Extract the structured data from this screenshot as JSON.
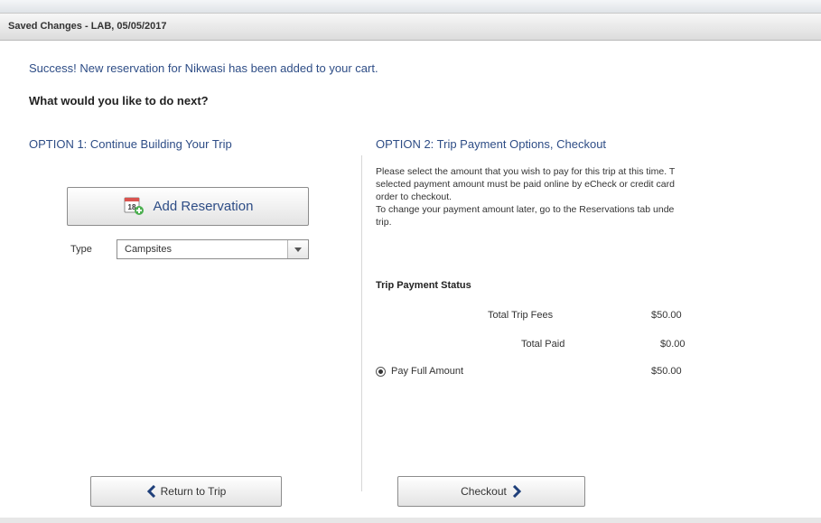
{
  "dialog": {
    "title": "Saved Changes - LAB, 05/05/2017"
  },
  "messages": {
    "success": "Success! New reservation for Nikwasi has been added to your cart.",
    "next": "What would you like to do next?"
  },
  "option1": {
    "heading": "OPTION 1: Continue Building Your Trip",
    "add_button": "Add Reservation",
    "type_label": "Type",
    "type_selected": "Campsites",
    "return_button": "Return to Trip"
  },
  "option2": {
    "heading": "OPTION 2: Trip Payment Options, Checkout",
    "paragraph_lines": [
      "Please select the amount that you wish to pay for this trip at this time. T",
      "selected payment amount must be paid online by eCheck or credit card",
      "order to checkout.",
      "To change your payment amount later, go to the Reservations tab unde",
      "trip."
    ],
    "payment_status_title": "Trip Payment Status",
    "total_fees_label": "Total Trip Fees",
    "total_fees_value": "$50.00",
    "total_paid_label": "Total Paid",
    "total_paid_value": "$0.00",
    "pay_full_label": "Pay Full Amount",
    "pay_full_value": "$50.00",
    "checkout_button": "Checkout"
  },
  "icons": {
    "calendar_day": "18"
  },
  "colors": {
    "heading_blue": "#2e4d86",
    "add_icon_green": "#4caf50",
    "calendar_red": "#d9534f"
  }
}
